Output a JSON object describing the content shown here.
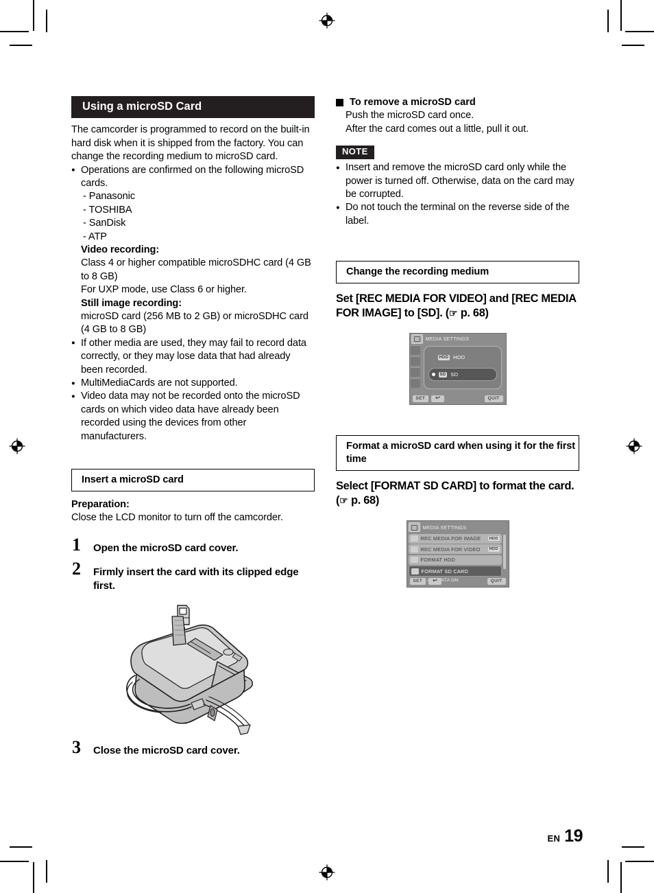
{
  "page": {
    "footer_lang": "EN",
    "footer_number": "19"
  },
  "left_column": {
    "section_title": "Using a microSD Card",
    "intro": "The camcorder is programmed to record on the built-in hard disk when it is shipped from the factory. You can change the recording medium to microSD card.",
    "bullet_operations": "Operations are confirmed on the following microSD cards.",
    "card_brands": [
      "- Panasonic",
      "- TOSHIBA",
      "- SanDisk",
      "- ATP"
    ],
    "video_recording_label": "Video recording:",
    "video_recording_lines": [
      "Class 4 or higher compatible microSDHC card (4 GB to 8 GB)",
      "For UXP mode, use Class 6 or higher."
    ],
    "still_image_label": "Still image recording:",
    "still_image_lines": [
      "microSD card (256 MB to 2 GB) or microSDHC card (4 GB to 8 GB)"
    ],
    "bullets": [
      "If other media are used, they may fail to record data correctly, or they may lose data that had already been recorded.",
      "MultiMediaCards are not supported.",
      "Video data may not be recorded onto the microSD cards on which video data have already been recorded using the devices from other manufacturers."
    ],
    "insert_box_title": "Insert a microSD card",
    "preparation_label": "Preparation:",
    "preparation_text": "Close the LCD monitor to turn off the camcorder.",
    "steps": [
      {
        "number": "1",
        "text": "Open the microSD card cover."
      },
      {
        "number": "2",
        "text": "Firmly insert the card with its clipped edge first."
      },
      {
        "number": "3",
        "text": "Close the microSD card cover."
      }
    ]
  },
  "right_column": {
    "remove_heading": "To remove a microSD card",
    "remove_lines": [
      "Push the microSD card once.",
      "After the card comes out a little, pull it out."
    ],
    "note_label": "NOTE",
    "note_bullets": [
      "Insert and remove the microSD card only while the power is turned off. Otherwise, data on the card may be corrupted.",
      "Do not touch the terminal on the reverse side of the label."
    ],
    "change_box_title": "Change the recording medium",
    "change_lead": "Set [REC MEDIA FOR VIDEO] and [REC MEDIA FOR IMAGE] to [SD]. (",
    "change_lead_ref": " p. 68)",
    "format_box_title": "Format a microSD card when using it for the first time",
    "format_lead": "Select [FORMAT SD CARD] to format the card. (",
    "format_lead_ref": " p. 68)",
    "hand_icon": "hand-pointer-icon"
  },
  "lcd_screen_1": {
    "title": "MEDIA SETTINGS",
    "options": [
      {
        "badge": "HDD",
        "label": "HDD",
        "selected": false
      },
      {
        "badge": "SD",
        "label": "SD",
        "selected": true
      }
    ],
    "keys": {
      "set": "SET",
      "back": "↩",
      "quit": "QUIT"
    }
  },
  "lcd_screen_2": {
    "title": "MEDIA SETTINGS",
    "rows": [
      {
        "label": "REC MEDIA FOR IMAGE",
        "tail": "HDD",
        "style": "light"
      },
      {
        "label": "REC MEDIA FOR VIDEO",
        "tail": "HDD",
        "style": "light"
      },
      {
        "label": "FORMAT HDD",
        "tail": "",
        "style": "light"
      },
      {
        "label": "FORMAT SD CARD",
        "tail": "",
        "style": "dark"
      }
    ],
    "caption": "ERASE ALL DATA ON",
    "keys": {
      "set": "SET",
      "back": "↩",
      "quit": "QUIT"
    }
  }
}
